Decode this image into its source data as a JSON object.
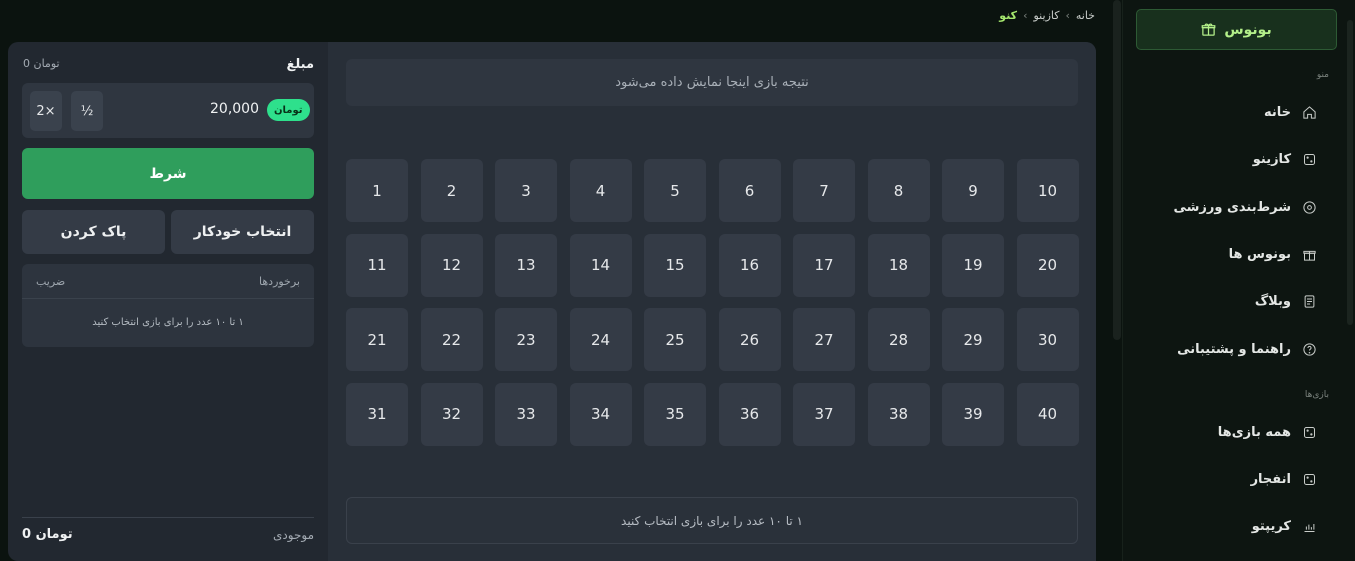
{
  "breadcrumb": {
    "home": "خانه",
    "casino": "کازینو",
    "current": "کنو",
    "separator": "›"
  },
  "sidebar": {
    "bonus_button": "بونوس",
    "menu_title": "منو",
    "items": [
      {
        "label": "خانه",
        "icon": "home-icon"
      },
      {
        "label": "کازینو",
        "icon": "dice-icon"
      },
      {
        "label": "شرط‌بندی ورزشی",
        "icon": "ball-icon"
      },
      {
        "label": "بونوس ها",
        "icon": "gift-icon"
      },
      {
        "label": "وبلاگ",
        "icon": "blog-icon"
      },
      {
        "label": "راهنما و پشتیبانی",
        "icon": "help-icon"
      }
    ],
    "games_title": "بازی‌ها",
    "games": [
      {
        "label": "همه بازی‌ها",
        "icon": "dice-icon"
      },
      {
        "label": "انفجار",
        "icon": "dice-icon"
      },
      {
        "label": "کریپتو",
        "icon": "chart-icon"
      }
    ]
  },
  "board": {
    "result_text": "نتیجه بازی اینجا نمایش داده می‌شود",
    "numbers": [
      1,
      2,
      3,
      4,
      5,
      6,
      7,
      8,
      9,
      10,
      11,
      12,
      13,
      14,
      15,
      16,
      17,
      18,
      19,
      20,
      21,
      22,
      23,
      24,
      25,
      26,
      27,
      28,
      29,
      30,
      31,
      32,
      33,
      34,
      35,
      36,
      37,
      38,
      39,
      40
    ],
    "hint": "۱ تا ۱۰ عدد را برای بازی انتخاب کنید"
  },
  "bet_panel": {
    "amount_label": "مبلغ",
    "max_amount": "تومان 0",
    "amount_value": "20,000",
    "currency": "تومان",
    "half_label": "½",
    "double_label": "2×",
    "bet_button": "شرط",
    "auto_pick": "انتخاب خودکار",
    "clear": "پاک کردن",
    "hits_header": "برخوردها",
    "multiplier_header": "ضریب",
    "hits_hint": "۱ تا ۱۰ عدد را برای بازی انتخاب کنید",
    "balance_label": "موجودی",
    "balance_value": "تومان 0"
  },
  "colors": {
    "accent_green": "#2f9e5c",
    "badge_green": "#2ee08c",
    "breadcrumb_active": "#a6e86e"
  }
}
